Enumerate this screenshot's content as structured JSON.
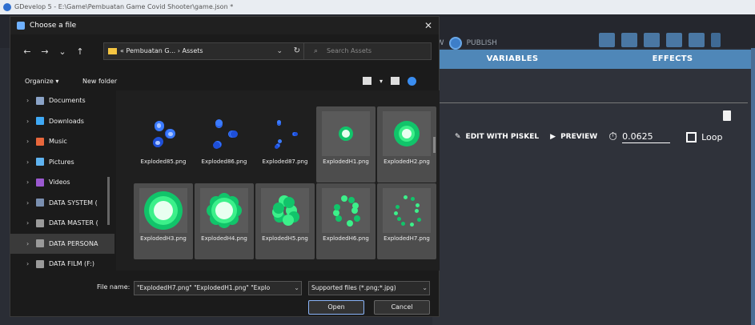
{
  "app": {
    "window_title": "GDevelop 5 - E:\\Game\\Pembuatan Game Covid Shooter\\game.json *",
    "publish_prefix": "EW",
    "publish_label": "PUBLISH"
  },
  "tabs": [
    "VARIABLES",
    "EFFECTS"
  ],
  "animation_row": {
    "edit_label": "EDIT WITH PISKEL",
    "preview_label": "PREVIEW",
    "frame_time": "0.0625",
    "loop_label": "Loop",
    "loop_checked": false
  },
  "dialog": {
    "title": "Choose a file",
    "close_symbol": "✕",
    "nav_buttons": [
      "←",
      "→",
      "⌄",
      "↑"
    ],
    "address_path": "« Pembuatan G...  ›  Assets",
    "address_chevron": "⌄",
    "refresh_symbol": "↻",
    "search_placeholder": "Search Assets",
    "organize_label": "Organize ▾",
    "new_folder_label": "New folder",
    "nav_items": [
      {
        "label": "Documents",
        "icon_color": "#8aa3c7",
        "icon": "documents-icon"
      },
      {
        "label": "Downloads",
        "icon_color": "#3fa9f5",
        "icon": "downloads-icon"
      },
      {
        "label": "Music",
        "icon_color": "#e8673c",
        "icon": "music-icon"
      },
      {
        "label": "Pictures",
        "icon_color": "#5fb3f0",
        "icon": "pictures-icon"
      },
      {
        "label": "Videos",
        "icon_color": "#9b59d0",
        "icon": "videos-icon"
      },
      {
        "label": "DATA SYSTEM (",
        "icon_color": "#7a8fb0",
        "icon": "drive-icon"
      },
      {
        "label": "DATA MASTER (",
        "icon_color": "#9a9a9a",
        "icon": "drive-icon"
      },
      {
        "label": "DATA PERSONA",
        "icon_color": "#9a9a9a",
        "icon": "drive-icon",
        "selected": true
      },
      {
        "label": "DATA FILM (F:)",
        "icon_color": "#9a9a9a",
        "icon": "drive-icon"
      }
    ],
    "files": [
      {
        "name": "Exploded85.png",
        "style": "blue",
        "selected": false
      },
      {
        "name": "Exploded86.png",
        "style": "blue-ring",
        "selected": false
      },
      {
        "name": "Exploded87.png",
        "style": "blue-sparse",
        "selected": false
      },
      {
        "name": "ExplodedH1.png",
        "style": "green-small",
        "selected": true
      },
      {
        "name": "ExplodedH2.png",
        "style": "green-medium",
        "selected": true
      },
      {
        "name": "ExplodedH3.png",
        "style": "green-large",
        "selected": true
      },
      {
        "name": "ExplodedH4.png",
        "style": "green-burst",
        "selected": true
      },
      {
        "name": "ExplodedH5.png",
        "style": "green-chunks",
        "selected": true
      },
      {
        "name": "ExplodedH6.png",
        "style": "green-ring",
        "selected": true
      },
      {
        "name": "ExplodedH7.png",
        "style": "green-sparse",
        "selected": true
      },
      {
        "name": "",
        "style": "red-partial",
        "selected": false
      },
      {
        "name": "",
        "style": "red-partial",
        "selected": false
      },
      {
        "name": "",
        "style": "red-partial",
        "selected": false
      },
      {
        "name": "",
        "style": "red-partial",
        "selected": false
      },
      {
        "name": "",
        "style": "red-partial",
        "selected": false
      }
    ],
    "file_name_label": "File name:",
    "file_name_value": "\"ExplodedH7.png\" \"ExplodedH1.png\" \"Explo",
    "file_type_value": "Supported files (*.png;*.jpg)",
    "select_chevron": "⌄",
    "open_label": "Open",
    "cancel_label": "Cancel"
  }
}
